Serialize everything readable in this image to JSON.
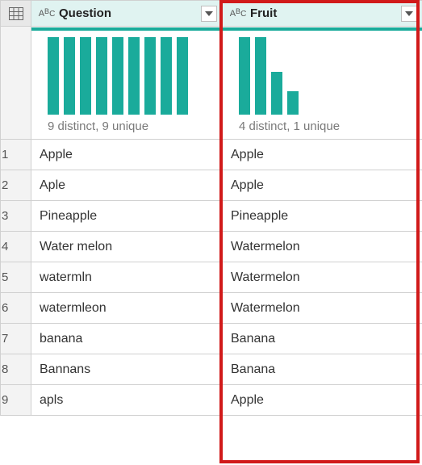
{
  "columns": [
    {
      "name": "Question",
      "type_icon": "abc-type-icon",
      "profile_summary": "9 distinct, 9 unique",
      "bar_heights_pct": [
        100,
        100,
        100,
        100,
        100,
        100,
        100,
        100,
        100
      ]
    },
    {
      "name": "Fruit",
      "type_icon": "abc-type-icon",
      "profile_summary": "4 distinct, 1 unique",
      "bar_heights_pct": [
        100,
        100,
        55,
        30
      ]
    }
  ],
  "rows": [
    {
      "n": "1",
      "Question": "Apple",
      "Fruit": "Apple"
    },
    {
      "n": "2",
      "Question": "Aple",
      "Fruit": "Apple"
    },
    {
      "n": "3",
      "Question": "Pineapple",
      "Fruit": "Pineapple"
    },
    {
      "n": "4",
      "Question": "Water melon",
      "Fruit": "Watermelon"
    },
    {
      "n": "5",
      "Question": "watermln",
      "Fruit": "Watermelon"
    },
    {
      "n": "6",
      "Question": "watermleon",
      "Fruit": "Watermelon"
    },
    {
      "n": "7",
      "Question": "banana",
      "Fruit": "Banana"
    },
    {
      "n": "8",
      "Question": "Bannans",
      "Fruit": "Banana"
    },
    {
      "n": "9",
      "Question": "apls",
      "Fruit": "Apple"
    }
  ],
  "colors": {
    "accent": "#1aab9b",
    "highlight": "#d11a1a"
  }
}
